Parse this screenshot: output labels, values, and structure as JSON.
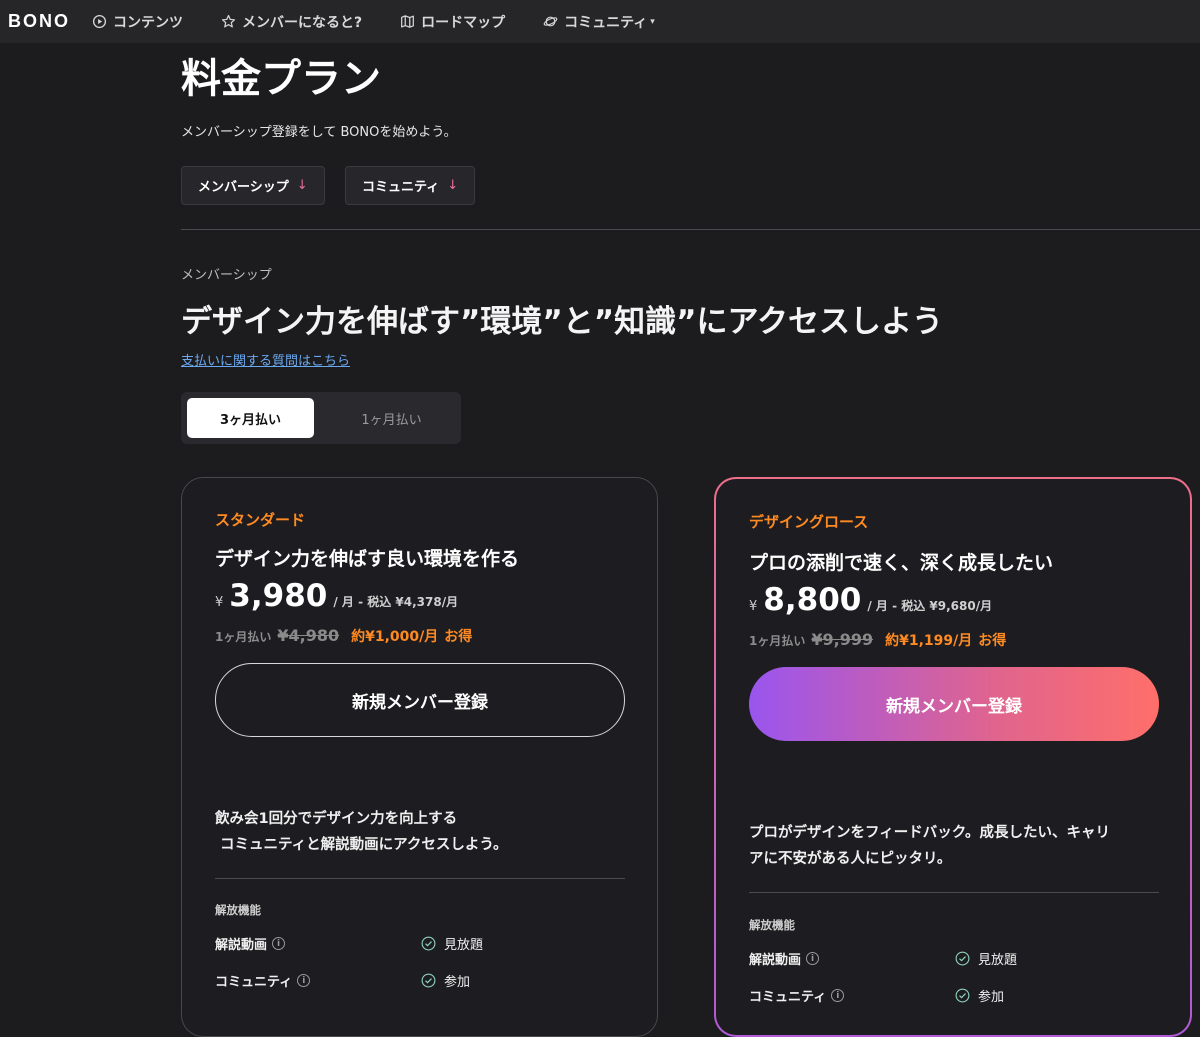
{
  "nav": {
    "logo": "BONO",
    "items": [
      {
        "label": "コンテンツ",
        "icon": "play-circle-icon"
      },
      {
        "label": "メンバーになると?",
        "icon": "star-icon"
      },
      {
        "label": "ロードマップ",
        "icon": "map-icon"
      },
      {
        "label": "コミュニティ",
        "icon": "planet-icon",
        "caret": "▾"
      }
    ]
  },
  "page": {
    "title": "料金プラン",
    "subtitle": "メンバーシップ登録をして BONOを始めよう。",
    "jump_buttons": [
      {
        "label": "メンバーシップ",
        "arrow": "↓"
      },
      {
        "label": "コミュニティ",
        "arrow": "↓"
      }
    ]
  },
  "membership": {
    "section_label": "メンバーシップ",
    "headline": "デザイン力を伸ばす”環境”と”知識”にアクセスしよう",
    "faq_link": "支払いに関する質問はこちら",
    "billing_toggle": {
      "active": "3ヶ月払い",
      "inactive": "1ヶ月払い"
    }
  },
  "plans": [
    {
      "name": "スタンダード",
      "tagline": "デザイン力を伸ばす良い環境を作る",
      "yen": "¥",
      "price": "3,980",
      "per": "/ 月 - 税込 ¥4,378/月",
      "compare_label": "1ヶ月払い",
      "compare_old": "¥4,980",
      "save_text": "約¥1,000/月",
      "save_suffix": "お得",
      "cta": "新規メンバー登録",
      "description_line1": "飲み会1回分でデザイン力を向上する",
      "description_line2": "コミュニティと解説動画にアクセスしよう。",
      "features_label": "解放機能",
      "features": [
        {
          "name": "解説動画",
          "value": "見放題"
        },
        {
          "name": "コミュニティ",
          "value": "参加"
        }
      ]
    },
    {
      "name": "デザイングロース",
      "tagline": "プロの添削で速く、深く成長したい",
      "yen": "¥",
      "price": "8,800",
      "per": "/ 月 - 税込 ¥9,680/月",
      "compare_label": "1ヶ月払い",
      "compare_old": "¥9,999",
      "save_text": "約¥1,199/月",
      "save_suffix": "お得",
      "cta": "新規メンバー登録",
      "description_line1": "プロがデザインをフィードバック。成長したい、キャリ",
      "description_line2": "アに不安がある人にピッタリ。",
      "features_label": "解放機能",
      "features": [
        {
          "name": "解説動画",
          "value": "見放題"
        },
        {
          "name": "コミュニティ",
          "value": "参加"
        }
      ]
    }
  ],
  "colors": {
    "accent_orange": "#ff8a22",
    "link_blue": "#6aa8f0",
    "arrow_pink": "#e8719a",
    "gradient": [
      "#9a55ee",
      "#ff6f6a"
    ]
  }
}
